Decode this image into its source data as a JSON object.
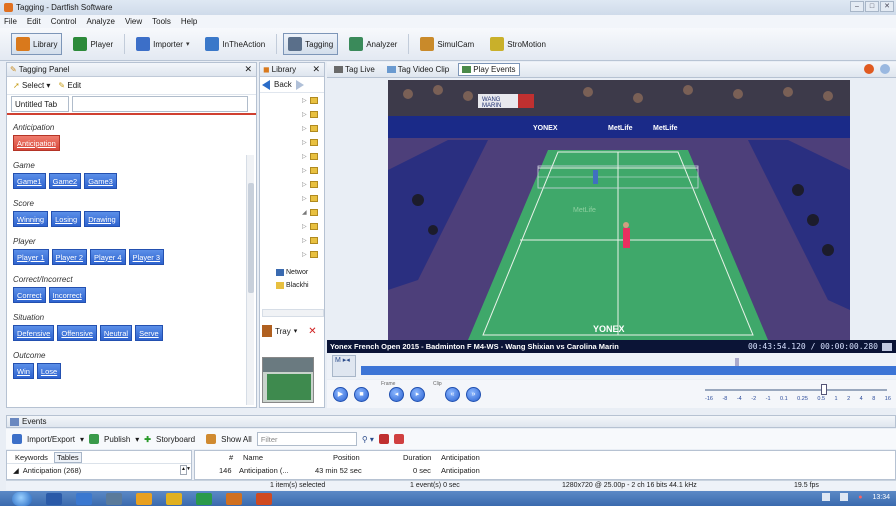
{
  "window": {
    "title": "Tagging - Dartfish Software",
    "controls": [
      "–",
      "□",
      "✕"
    ]
  },
  "menu": [
    "File",
    "Edit",
    "Control",
    "Analyze",
    "View",
    "Tools",
    "Help"
  ],
  "toolbar": {
    "library": "Library",
    "player": "Player",
    "importer": "Importer",
    "intheaction": "InTheAction",
    "tagging": "Tagging",
    "analyzer": "Analyzer",
    "simulcam": "SimulCam",
    "stromotion": "StroMotion",
    "colors": {
      "library": "#d9791c",
      "player": "#2c8a3a",
      "importer": "#3c6fc8",
      "intheaction": "#3a78c9",
      "tagging": "#5a6f8a",
      "analyzer": "#3a8a5a",
      "simulcam": "#c98a2a",
      "stromotion": "#c9b02a"
    }
  },
  "tagging_panel": {
    "header": "Tagging Panel",
    "close": "✕",
    "select": "Select",
    "edit": "Edit",
    "tab_name": "Untitled Tab",
    "categories": [
      {
        "title": "Anticipation",
        "buttons": [
          "Anticipation"
        ],
        "color": "red"
      },
      {
        "title": "Game",
        "buttons": [
          "Game1",
          "Game2",
          "Game3"
        ]
      },
      {
        "title": "Score",
        "buttons": [
          "Winning",
          "Losing",
          "Drawing"
        ]
      },
      {
        "title": "Player",
        "buttons": [
          "Player 1",
          "Player 2",
          "Player 4",
          "Player 3"
        ]
      },
      {
        "title": "Correct/Incorrect",
        "buttons": [
          "Correct",
          "Incorrect"
        ]
      },
      {
        "title": "Situation",
        "buttons": [
          "Defensive",
          "Offensive",
          "Neutral",
          "Serve"
        ]
      },
      {
        "title": "Outcome",
        "buttons": [
          "Win",
          "Lose"
        ]
      }
    ]
  },
  "library_panel": {
    "header": "Library",
    "close": "✕",
    "back": "Back",
    "tree_items": [
      "Networ",
      "Blackhi"
    ],
    "tray": "Tray"
  },
  "viewer": {
    "tabs": [
      "Tag Live",
      "Tag Video Clip",
      "Play Events"
    ],
    "active_tab": "Play Events",
    "caption": "Yonex French Open 2015 - Badminton F M4-WS - Wang Shixian vs Carolina Marin",
    "timecode": "00:43:54.120 / 00:00:00.280",
    "scoreboard": {
      "p1": "WANG",
      "p2": "MARIN",
      "s1": "1 1 3",
      "s2": "2 1 1"
    },
    "brand": "YONEX",
    "sponsor": "MetLife",
    "speed_ticks": [
      "-16",
      "-8",
      "-4",
      "-2",
      "-1",
      "0.1",
      "0.25",
      "0.5",
      "1",
      "2",
      "4",
      "8",
      "16"
    ],
    "ctrl_labels": [
      "Frame",
      "Clip"
    ]
  },
  "events": {
    "header": "Events",
    "toolbar": {
      "import_export": "Import/Export",
      "publish": "Publish",
      "storyboard": "Storyboard",
      "show_all": "Show All",
      "filter_placeholder": "Filter"
    },
    "left_tabs": [
      "Keywords",
      "Tables"
    ],
    "tree_row": "Anticipation (268)",
    "columns": [
      "#",
      "Name",
      "Position",
      "Duration",
      "Anticipation"
    ],
    "rows": [
      {
        "num": "146",
        "name": "Anticipation (...",
        "position": "43 min 52 sec",
        "duration": "0 sec",
        "anticipation": "Anticipation"
      }
    ]
  },
  "status": {
    "selected": "1 item(s) selected",
    "events": "1 event(s) 0 sec",
    "format": "1280x720 @ 25.00p - 2 ch 16 bits 44.1 kHz",
    "fps": "19.5 fps"
  },
  "taskbar": {
    "clock": "13:34"
  }
}
